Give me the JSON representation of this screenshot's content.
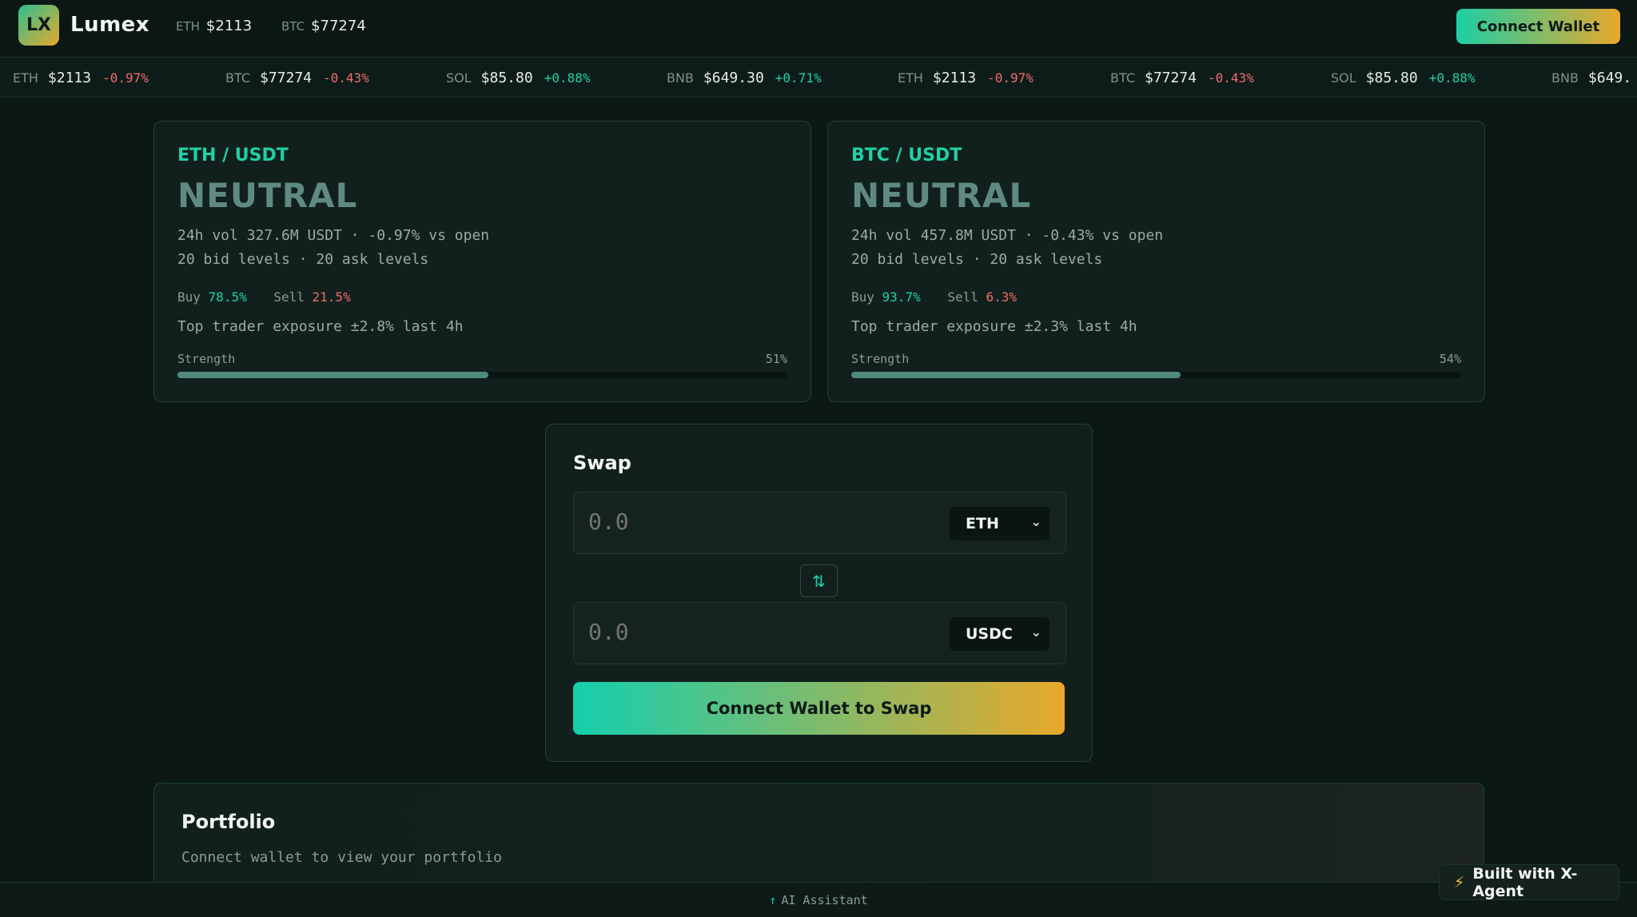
{
  "header": {
    "logo_text": "LX",
    "brand": "Lumex",
    "prices": [
      {
        "symbol": "ETH",
        "value": "$2113"
      },
      {
        "symbol": "BTC",
        "value": "$77274"
      }
    ],
    "connect_label": "Connect Wallet"
  },
  "ticker": [
    {
      "symbol": "ETH",
      "price": "$2113",
      "change": "-0.97%"
    },
    {
      "symbol": "BTC",
      "price": "$77274",
      "change": "-0.43%"
    },
    {
      "symbol": "SOL",
      "price": "$85.80",
      "change": "+0.88%"
    },
    {
      "symbol": "BNB",
      "price": "$649.30",
      "change": "+0.71%"
    },
    {
      "symbol": "ETH",
      "price": "$2113",
      "change": "-0.97%"
    },
    {
      "symbol": "BTC",
      "price": "$77274",
      "change": "-0.43%"
    },
    {
      "symbol": "SOL",
      "price": "$85.80",
      "change": "+0.88%"
    },
    {
      "symbol": "BNB",
      "price": "$649.",
      "change": ""
    }
  ],
  "signals": [
    {
      "pair": "ETH / USDT",
      "signal": "NEUTRAL",
      "volume_line": "24h vol 327.6M USDT · -0.97% vs open",
      "levels_line": "20 bid levels · 20 ask levels",
      "buy_label": "Buy",
      "buy_pct": "78.5%",
      "sell_label": "Sell",
      "sell_pct": "21.5%",
      "exposure_line": "Top trader exposure ±2.8% last 4h",
      "strength_label": "Strength",
      "strength_pct": "51%",
      "strength_value": 0.51
    },
    {
      "pair": "BTC / USDT",
      "signal": "NEUTRAL",
      "volume_line": "24h vol 457.8M USDT · -0.43% vs open",
      "levels_line": "20 bid levels · 20 ask levels",
      "buy_label": "Buy",
      "buy_pct": "93.7%",
      "sell_label": "Sell",
      "sell_pct": "6.3%",
      "exposure_line": "Top trader exposure ±2.3% last 4h",
      "strength_label": "Strength",
      "strength_pct": "54%",
      "strength_value": 0.54
    }
  ],
  "swap": {
    "title": "Swap",
    "from_placeholder": "0.0",
    "from_token": "ETH",
    "to_placeholder": "0.0",
    "to_token": "USDC",
    "flip_icon": "⇅",
    "button_label": "Connect Wallet to Swap"
  },
  "portfolio": {
    "title": "Portfolio",
    "subtitle": "Connect wallet to view your portfolio"
  },
  "footer": {
    "ai_arrow": "↑",
    "ai_label": "AI Assistant",
    "built_icon": "⚡",
    "built_label": "Built with X-Agent"
  },
  "colors": {
    "accent": "#1fd1a6",
    "negative": "#f06b6b",
    "gradient_start": "#1ccfa6",
    "gradient_end": "#e8a82b"
  }
}
